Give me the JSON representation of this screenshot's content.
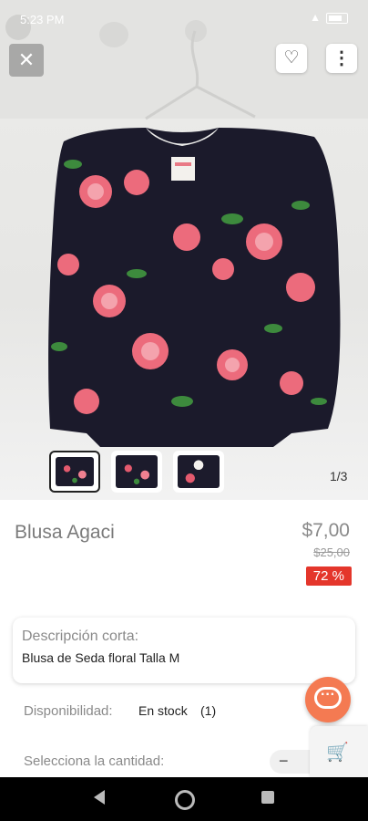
{
  "status_bar": {
    "time": "5:23 PM",
    "icons": "⊘ ⏰",
    "right": "▲"
  },
  "header": {
    "close_label": "✕",
    "fav_label": "♡",
    "more_label": "⋮"
  },
  "gallery": {
    "counter": "1/3",
    "thumbnails": [
      "Blusa floral frente",
      "Blusa floral detalle",
      "Blusa floral etiqueta"
    ]
  },
  "product": {
    "title": "Blusa Agaci",
    "price": "$7,00",
    "old_price": "$25,00",
    "discount": "72 %",
    "short_desc_label": "Descripción corta:",
    "short_desc": "Blusa de Seda floral Talla M",
    "availability_label": "Disponibilidad:",
    "availability_value": "En stock",
    "availability_count": "(1)",
    "quantity_label": "Selecciona la cantidad:",
    "quantity_minus": "−"
  },
  "colors": {
    "accent": "#f47a52",
    "discount": "#e4362b"
  }
}
